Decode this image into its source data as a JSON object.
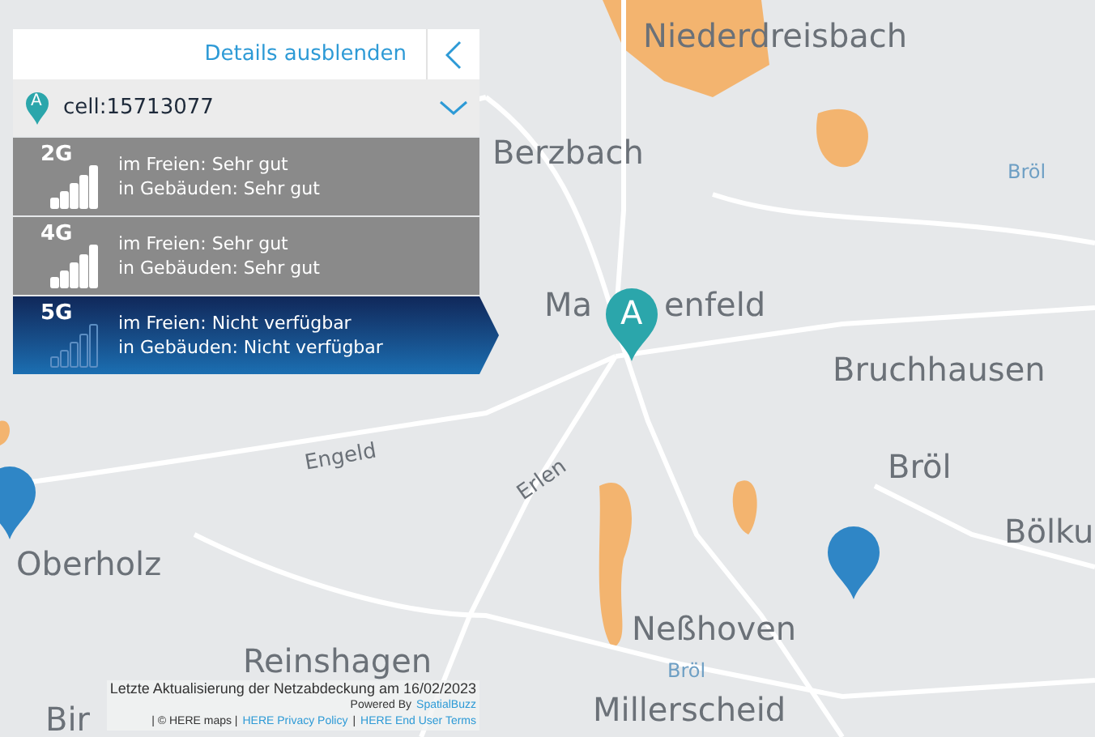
{
  "panel": {
    "hide_details": {
      "label": "Details ausblenden"
    },
    "cell": {
      "marker": "A",
      "id": "cell:15713077"
    },
    "technologies": [
      {
        "name": "2G",
        "outdoor": "im Freien: Sehr gut",
        "indoor": "in Gebäuden: Sehr gut",
        "available": true,
        "selected": false
      },
      {
        "name": "4G",
        "outdoor": "im Freien: Sehr gut",
        "indoor": "in Gebäuden: Sehr gut",
        "available": true,
        "selected": false
      },
      {
        "name": "5G",
        "outdoor": "im Freien: Nicht verfügbar",
        "indoor": "in Gebäuden: Nicht verfügbar",
        "available": false,
        "selected": true
      }
    ]
  },
  "map": {
    "labels": [
      {
        "text": "Niederdreisbach",
        "kind": "town"
      },
      {
        "text": "Berzbach",
        "kind": "town"
      },
      {
        "text": "Bröl",
        "kind": "river"
      },
      {
        "text": "Ma",
        "kind": "town"
      },
      {
        "text": "enfeld",
        "kind": "town"
      },
      {
        "text": "Bruchhausen",
        "kind": "town"
      },
      {
        "text": "Bröl",
        "kind": "town"
      },
      {
        "text": "Bölku",
        "kind": "town"
      },
      {
        "text": "Engeld",
        "kind": "street"
      },
      {
        "text": "Erlen",
        "kind": "street"
      },
      {
        "text": "Oberholz",
        "kind": "town"
      },
      {
        "text": "Neßhoven",
        "kind": "town"
      },
      {
        "text": "Bröl",
        "kind": "river"
      },
      {
        "text": "Reinshagen",
        "kind": "town"
      },
      {
        "text": "Millerscheid",
        "kind": "town"
      },
      {
        "text": "Bir",
        "kind": "town"
      }
    ],
    "pins": [
      {
        "kind": "cell",
        "label": "A"
      },
      {
        "kind": "plain"
      },
      {
        "kind": "plain"
      }
    ]
  },
  "footer": {
    "update": "Letzte Aktualisierung der Netzabdeckung am 16/02/2023",
    "powered_by": "Powered By",
    "powered_by_link": "SpatialBuzz",
    "attribution": [
      {
        "kind": "text",
        "text": "| © HERE maps |"
      },
      {
        "kind": "link",
        "text": "HERE Privacy Policy"
      },
      {
        "kind": "text",
        "text": "|"
      },
      {
        "kind": "link",
        "text": "HERE End User Terms"
      }
    ]
  }
}
